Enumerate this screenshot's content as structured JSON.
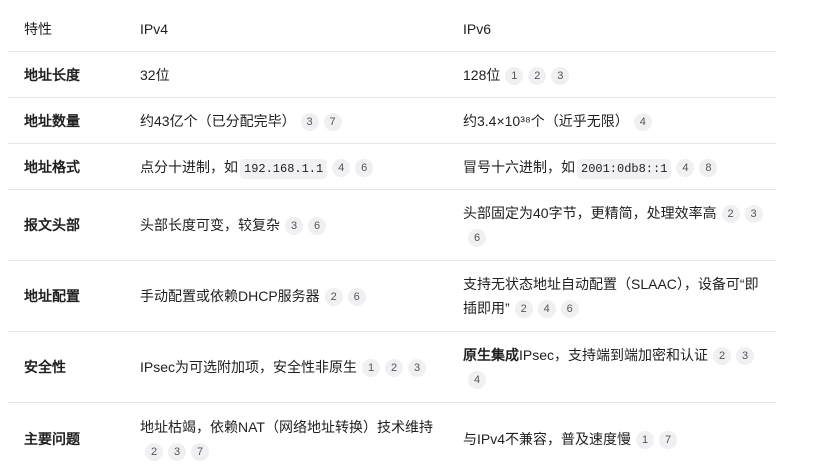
{
  "header": {
    "feature": "特性",
    "ipv4": "IPv4",
    "ipv6": "IPv6"
  },
  "rows": [
    {
      "label": "地址长度",
      "ipv4": {
        "text": "32位",
        "refs": []
      },
      "ipv6": {
        "text": "128位",
        "refs": [
          "1",
          "2",
          "3"
        ]
      }
    },
    {
      "label": "地址数量",
      "ipv4": {
        "text": "约43亿个（已分配完毕）",
        "refs": [
          "3",
          "7"
        ]
      },
      "ipv6": {
        "text": "约3.4×10³⁸个（近乎无限）",
        "refs": [
          "4"
        ]
      }
    },
    {
      "label": "地址格式",
      "ipv4": {
        "text": "点分十进制，如",
        "code": "192.168.1.1",
        "refs": [
          "4",
          "6"
        ]
      },
      "ipv6": {
        "text": "冒号十六进制，如",
        "code": "2001:0db8::1",
        "refs": [
          "4",
          "8"
        ]
      }
    },
    {
      "label": "报文头部",
      "ipv4": {
        "text": "头部长度可变，较复杂",
        "refs": [
          "3",
          "6"
        ]
      },
      "ipv6": {
        "text": "头部固定为40字节，更精简，处理效率高",
        "refs": [
          "2",
          "3",
          "6"
        ]
      }
    },
    {
      "label": "地址配置",
      "ipv4": {
        "text": "手动配置或依赖DHCP服务器",
        "refs": [
          "2",
          "6"
        ]
      },
      "ipv6": {
        "text": "支持无状态地址自动配置（SLAAC），设备可“即插即用”",
        "refs": [
          "2",
          "4",
          "6"
        ]
      }
    },
    {
      "label": "安全性",
      "ipv4": {
        "text": "IPsec为可选附加项，安全性非原生",
        "refs": [
          "1",
          "2",
          "3"
        ]
      },
      "ipv6": {
        "bold": "原生集成",
        "text": "IPsec，支持端到端加密和认证",
        "refs": [
          "2",
          "3",
          "4"
        ]
      }
    },
    {
      "label": "主要问题",
      "ipv4": {
        "text": "地址枯竭，依赖NAT（网络地址转换）技术维持",
        "refs": [
          "2",
          "3",
          "7"
        ]
      },
      "ipv6": {
        "text": "与IPv4不兼容，普及速度慢",
        "refs": [
          "1",
          "7"
        ]
      }
    }
  ]
}
